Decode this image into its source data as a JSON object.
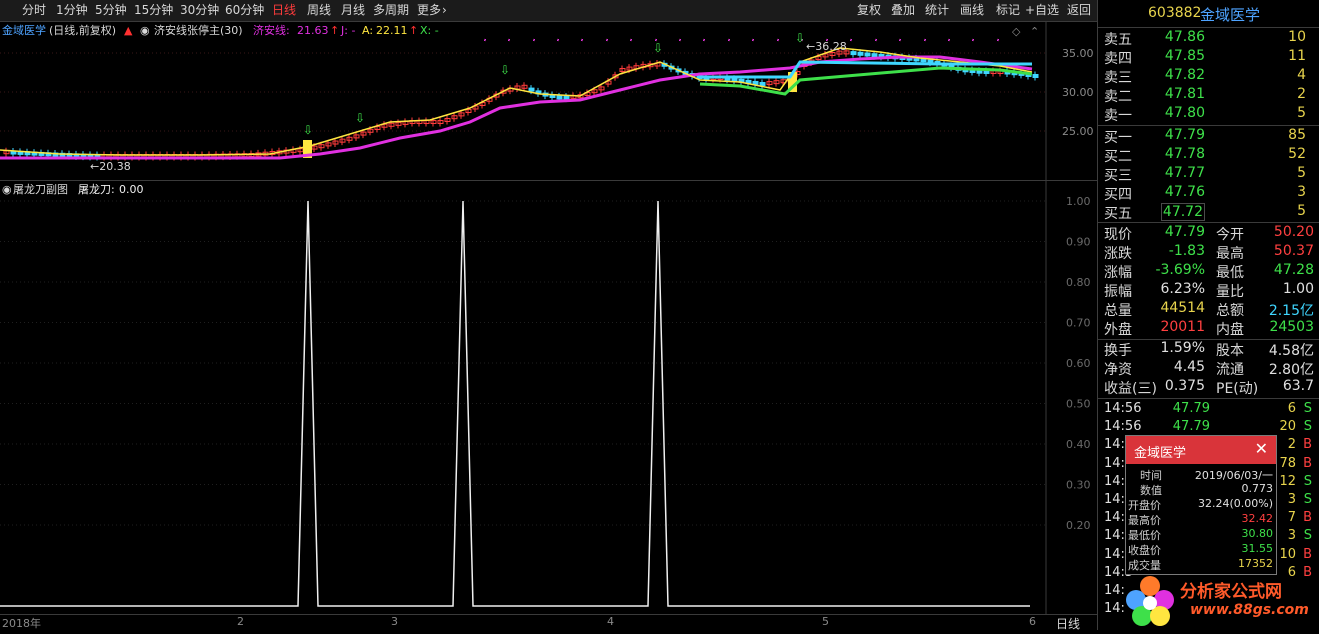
{
  "toolbar": {
    "left_items": [
      "分时",
      "1分钟",
      "5分钟",
      "15分钟",
      "30分钟",
      "60分钟",
      "日线",
      "周线",
      "月线",
      "多周期",
      "更多"
    ],
    "active": "日线",
    "right_items": [
      "复权",
      "叠加",
      "统计",
      "画线",
      "标记",
      "+自选",
      "返回"
    ]
  },
  "main_chart": {
    "stock_name": "金域医学",
    "mode": "(日线,前复权)",
    "indicator": "济安线张停主(30)",
    "ji_an_label": "济安线:",
    "ji_an_value": "21.63",
    "j_text": "J: -",
    "a_label": "A:",
    "a_value": "22.11",
    "x_text": "X: -",
    "low_mark": "20.38",
    "high_mark": "36.28",
    "y_ticks": [
      "35.00",
      "30.00",
      "25.00"
    ]
  },
  "sub_chart": {
    "title": "屠龙刀副图",
    "value_label": "屠龙刀:",
    "value": "0.00",
    "y_ticks": [
      "1.00",
      "0.90",
      "0.80",
      "0.70",
      "0.60",
      "0.50",
      "0.40",
      "0.30",
      "0.20"
    ]
  },
  "chart_data": {
    "type": "line",
    "title": "",
    "series": [
      {
        "name": "屠龙刀",
        "values": [
          0,
          1,
          0,
          1,
          0,
          1,
          0
        ]
      }
    ],
    "x_labels": [
      "2018年",
      "2",
      "3",
      "4",
      "5",
      "6"
    ],
    "ylim": [
      0,
      1
    ]
  },
  "bottom_axis": {
    "labels": [
      "2018年",
      "2",
      "3",
      "4",
      "5",
      "6"
    ],
    "period_button": "日线"
  },
  "right_panel": {
    "code": "603882",
    "name": "金域医学",
    "sells": [
      {
        "label": "卖五",
        "price": "47.86",
        "vol": "10"
      },
      {
        "label": "卖四",
        "price": "47.85",
        "vol": "11"
      },
      {
        "label": "卖三",
        "price": "47.82",
        "vol": "4"
      },
      {
        "label": "卖二",
        "price": "47.81",
        "vol": "2"
      },
      {
        "label": "卖一",
        "price": "47.80",
        "vol": "5"
      }
    ],
    "buys": [
      {
        "label": "买一",
        "price": "47.79",
        "vol": "85"
      },
      {
        "label": "买二",
        "price": "47.78",
        "vol": "52"
      },
      {
        "label": "买三",
        "price": "47.77",
        "vol": "5"
      },
      {
        "label": "买四",
        "price": "47.76",
        "vol": "3"
      },
      {
        "label": "买五",
        "price": "47.72",
        "vol": "5"
      }
    ],
    "quote": [
      {
        "l1": "现价",
        "v1": "47.79",
        "c1": "g",
        "l2": "今开",
        "v2": "50.20",
        "c2": "r"
      },
      {
        "l1": "涨跌",
        "v1": "-1.83",
        "c1": "g",
        "l2": "最高",
        "v2": "50.37",
        "c2": "r"
      },
      {
        "l1": "涨幅",
        "v1": "-3.69%",
        "c1": "g",
        "l2": "最低",
        "v2": "47.28",
        "c2": "g"
      },
      {
        "l1": "振幅",
        "v1": "6.23%",
        "c1": "w",
        "l2": "量比",
        "v2": "1.00",
        "c2": "w"
      },
      {
        "l1": "总量",
        "v1": "44514",
        "c1": "y",
        "l2": "总额",
        "v2": "2.15亿",
        "c2": "c"
      },
      {
        "l1": "外盘",
        "v1": "20011",
        "c1": "r",
        "l2": "内盘",
        "v2": "24503",
        "c2": "g"
      }
    ],
    "fund": [
      {
        "l1": "换手",
        "v1": "1.59%",
        "l2": "股本",
        "v2": "4.58亿"
      },
      {
        "l1": "净资",
        "v1": "4.45",
        "l2": "流通",
        "v2": "2.80亿"
      },
      {
        "l1": "收益(三)",
        "v1": "0.375",
        "l2": "PE(动)",
        "v2": "63.7"
      }
    ],
    "ticks": [
      {
        "time": "14:56",
        "price": "47.79",
        "vol": "6",
        "side": "S"
      },
      {
        "time": "14:56",
        "price": "47.79",
        "vol": "20",
        "side": "S"
      },
      {
        "time": "14:5",
        "price": "",
        "vol": "2",
        "side": "B"
      },
      {
        "time": "14:5",
        "price": "",
        "vol": "78",
        "side": "B"
      },
      {
        "time": "14:5",
        "price": "",
        "vol": "12",
        "side": "S"
      },
      {
        "time": "14:5",
        "price": "",
        "vol": "3",
        "side": "S"
      },
      {
        "time": "14:5",
        "price": "",
        "vol": "7",
        "side": "B"
      },
      {
        "time": "14:5",
        "price": "",
        "vol": "3",
        "side": "S"
      },
      {
        "time": "14:5",
        "price": "",
        "vol": "10",
        "side": "B"
      },
      {
        "time": "14:5",
        "price": "",
        "vol": "6",
        "side": "B"
      },
      {
        "time": "14:",
        "price": "",
        "vol": "",
        "side": ""
      },
      {
        "time": "14:",
        "price": "",
        "vol": "",
        "side": ""
      }
    ]
  },
  "popup": {
    "title": "金域医学",
    "rows": [
      {
        "label": "时间",
        "value": "2019/06/03/一",
        "color": "#e0e0e0"
      },
      {
        "label": "数值",
        "value": "0.773",
        "color": "#e0e0e0"
      },
      {
        "label": "开盘价",
        "value": "32.24(0.00%)",
        "color": "#e0e0e0"
      },
      {
        "label": "最高价",
        "value": "32.42",
        "color": "#ff4040"
      },
      {
        "label": "最低价",
        "value": "30.80",
        "color": "#3ee04a"
      },
      {
        "label": "收盘价",
        "value": "31.55",
        "color": "#3ee04a"
      },
      {
        "label": "成交量",
        "value": "17352",
        "color": "#e8d44d"
      }
    ]
  },
  "watermark": {
    "line1": "分析家公式网",
    "line2": "www.88gs.com"
  }
}
